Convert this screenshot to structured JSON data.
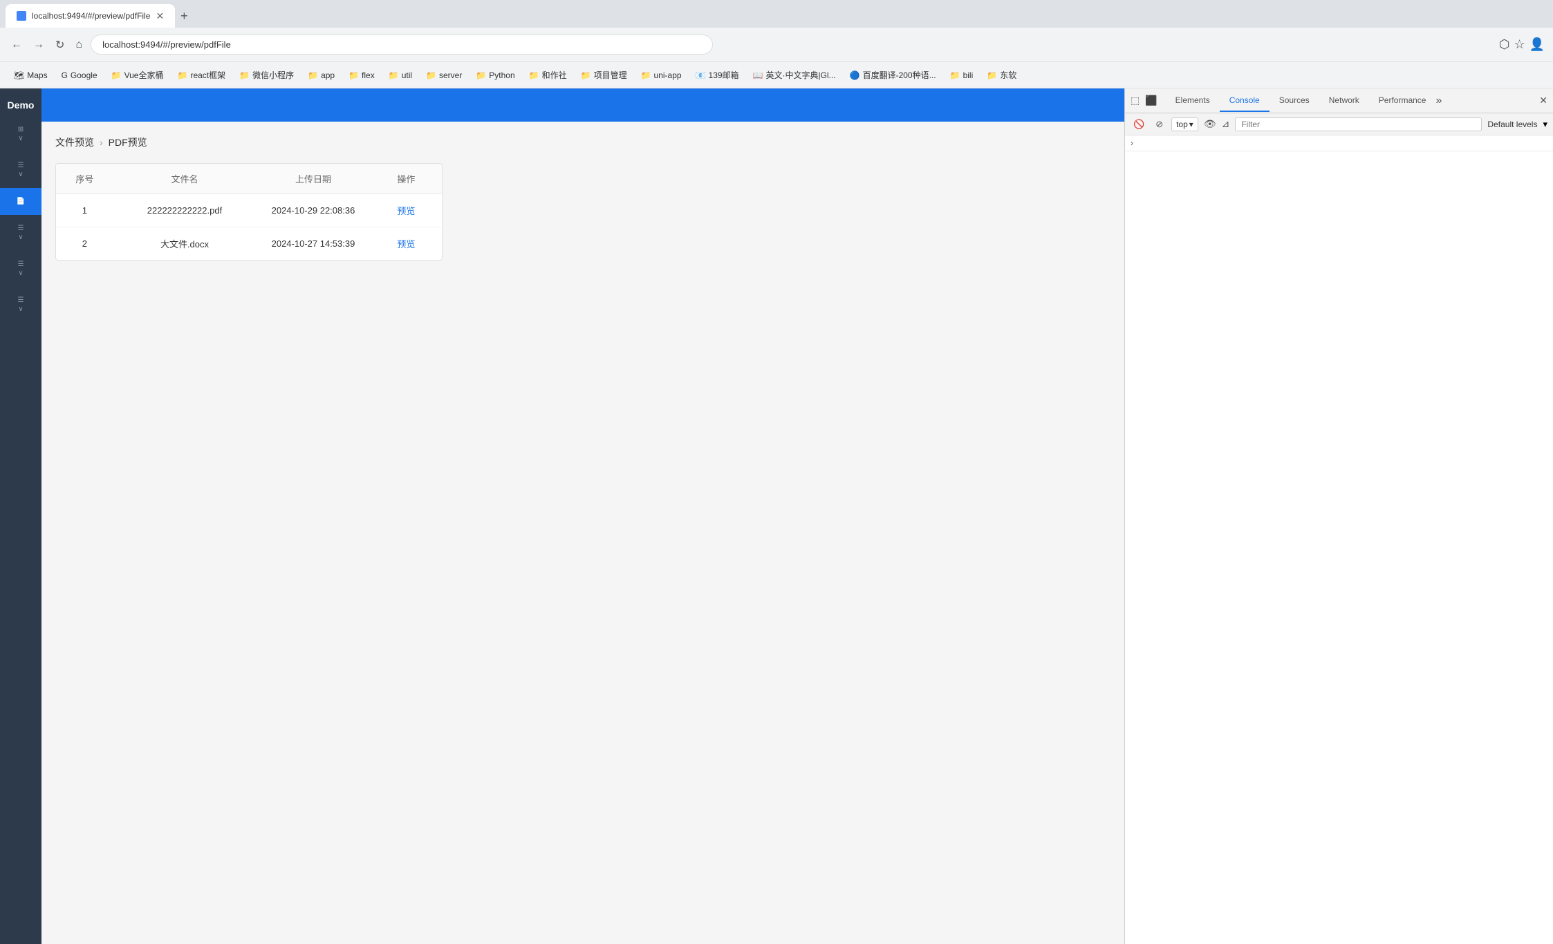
{
  "browser": {
    "tab_title": "localhost:9494/#/preview/pdfFile",
    "tab_favicon": "page",
    "address": "localhost:9494/#/preview/pdfFile",
    "bookmarks": [
      {
        "label": "Maps",
        "icon": "🗺"
      },
      {
        "label": "Google",
        "icon": "G"
      },
      {
        "label": "Vue全家桶",
        "icon": "📁"
      },
      {
        "label": "react框架",
        "icon": "📁"
      },
      {
        "label": "微信小程序",
        "icon": "📁"
      },
      {
        "label": "app",
        "icon": "📁"
      },
      {
        "label": "flex",
        "icon": "📁"
      },
      {
        "label": "util",
        "icon": "📁"
      },
      {
        "label": "server",
        "icon": "📁"
      },
      {
        "label": "Python",
        "icon": "📁"
      },
      {
        "label": "和作社",
        "icon": "📁"
      },
      {
        "label": "项目管理",
        "icon": "📁"
      },
      {
        "label": "uni-app",
        "icon": "📁"
      },
      {
        "label": "139邮箱",
        "icon": "📧"
      },
      {
        "label": "英文·中文字典|Gl...",
        "icon": "📖"
      },
      {
        "label": "百度翻译-200种语...",
        "icon": "🔵"
      },
      {
        "label": "bili",
        "icon": "📁"
      },
      {
        "label": "东软",
        "icon": "📁"
      }
    ]
  },
  "app": {
    "title": "Demo",
    "header_text": "",
    "sidebar_items": [
      {
        "label": "",
        "active": false
      },
      {
        "label": "",
        "active": false
      },
      {
        "label": "",
        "active": true
      },
      {
        "label": "",
        "active": false
      },
      {
        "label": "",
        "active": false
      },
      {
        "label": "",
        "active": false
      }
    ]
  },
  "page": {
    "breadcrumb_root": "文件预览",
    "breadcrumb_current": "PDF预览",
    "table": {
      "columns": [
        "序号",
        "文件名",
        "上传日期",
        "操作"
      ],
      "rows": [
        {
          "id": 1,
          "filename": "222222222222.pdf",
          "date": "2024-10-29 22:08:36",
          "action": "预览"
        },
        {
          "id": 2,
          "filename": "大文件.docx",
          "date": "2024-10-27 14:53:39",
          "action": "预览"
        }
      ]
    }
  },
  "devtools": {
    "tabs": [
      "Elements",
      "Console",
      "Sources",
      "Network",
      "Performance"
    ],
    "active_tab": "Console",
    "more_label": "»",
    "toolbar": {
      "top_selector": "top",
      "filter_placeholder": "Filter",
      "default_levels_label": "Default levels"
    }
  }
}
